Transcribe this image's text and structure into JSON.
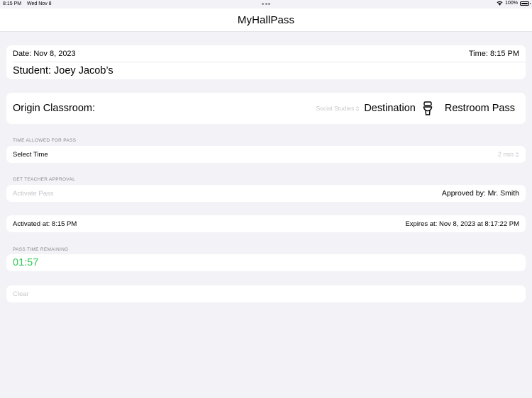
{
  "status_bar": {
    "time": "8:15 PM",
    "date": "Wed Nov 8",
    "battery": "100%"
  },
  "nav": {
    "title": "MyHallPass"
  },
  "pass_info": {
    "date": "Date: Nov 8, 2023",
    "time": "Time: 8:15 PM",
    "student": "Student: Joey Jacob’s"
  },
  "origin": {
    "label": "Origin Classroom:",
    "selected_classroom": "Social Studies",
    "destination_label": "Destination",
    "destination_value": "Restroom Pass",
    "destination_icon": "toilet-icon"
  },
  "time_allowed": {
    "header": "TIME ALLOWED FOR PASS",
    "label": "Select Time",
    "selected": "2 min"
  },
  "approval": {
    "header": "GET TEACHER APPROVAL",
    "activate_label": "Activate Pass",
    "approved_by": "Approved by: Mr. Smith"
  },
  "activation": {
    "activated_at": "Activated at: 8:15 PM",
    "expires_at": "Expires at: Nov 8, 2023 at 8:17:22 PM"
  },
  "remaining": {
    "header": "PASS TIME REMAINING",
    "countdown": "01:57",
    "countdown_color": "#34c759"
  },
  "actions": {
    "clear_label": "Clear"
  },
  "colors": {
    "background": "#f2f2f7",
    "placeholder": "#c7c7cc",
    "section_header": "#8a8a8e"
  }
}
